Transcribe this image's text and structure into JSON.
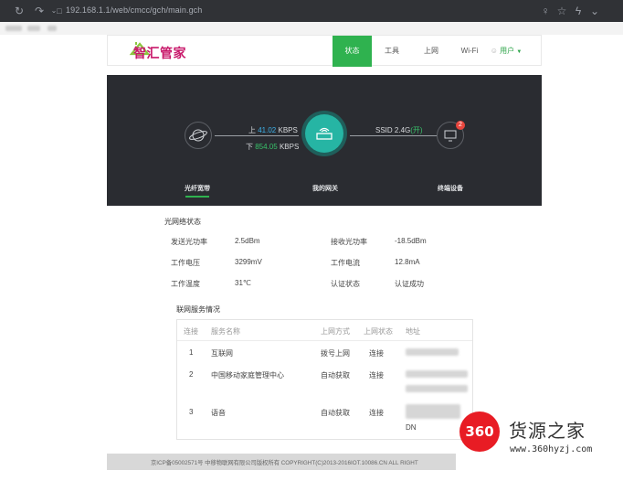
{
  "browser": {
    "url": "192.168.1.1/web/cmcc/gch/main.gch"
  },
  "header": {
    "logo": "智汇管家",
    "nav": [
      "状态",
      "工具",
      "上网",
      "Wi-Fi"
    ],
    "user": "用户"
  },
  "hero": {
    "up_prefix": "上",
    "up_value": "41.02",
    "up_unit": "KBPS",
    "down_prefix": "下",
    "down_value": "854.05",
    "down_unit": "KBPS",
    "ssid": "SSID 2.4G",
    "ssid_state": "(开)",
    "device_count": "2",
    "label_fiber": "光纤宽带",
    "label_gateway": "我的网关",
    "label_devices": "终端设备"
  },
  "optical": {
    "title": "光网络状态",
    "items": [
      {
        "label": "发送光功率",
        "value": "2.5dBm"
      },
      {
        "label": "接收光功率",
        "value": "-18.5dBm"
      },
      {
        "label": "工作电压",
        "value": "3299mV"
      },
      {
        "label": "工作电流",
        "value": "12.8mA"
      },
      {
        "label": "工作温度",
        "value": "31℃"
      },
      {
        "label": "认证状态",
        "value": "认证成功"
      }
    ]
  },
  "service": {
    "title": "联网服务情况",
    "headers": [
      "连接",
      "服务名称",
      "上网方式",
      "上网状态",
      "地址"
    ],
    "rows": [
      {
        "no": "1",
        "name": "互联网",
        "mode": "拨号上网",
        "status": "连接"
      },
      {
        "no": "2",
        "name": "中国移动家庭管理中心",
        "mode": "自动获取",
        "status": "连接"
      },
      {
        "no": "3",
        "name": "语音",
        "mode": "自动获取",
        "status": "连接"
      }
    ],
    "dns_fragment": "DN"
  },
  "footer": {
    "text": "京ICP备05002571号 中移物联网有限公司版权所有 COPYRIGHT(C)2013-2016IOT.10086.CN ALL RIGHT"
  },
  "watermark": {
    "badge": "360",
    "title": "货源之家",
    "url": "www.360hyzj.com"
  },
  "colors": {
    "accent": "#2fb24f",
    "hero_bg": "#2a2c31",
    "gateway": "#26b5a4",
    "up_rate": "#3db0e8",
    "down_rate": "#38c26a"
  }
}
